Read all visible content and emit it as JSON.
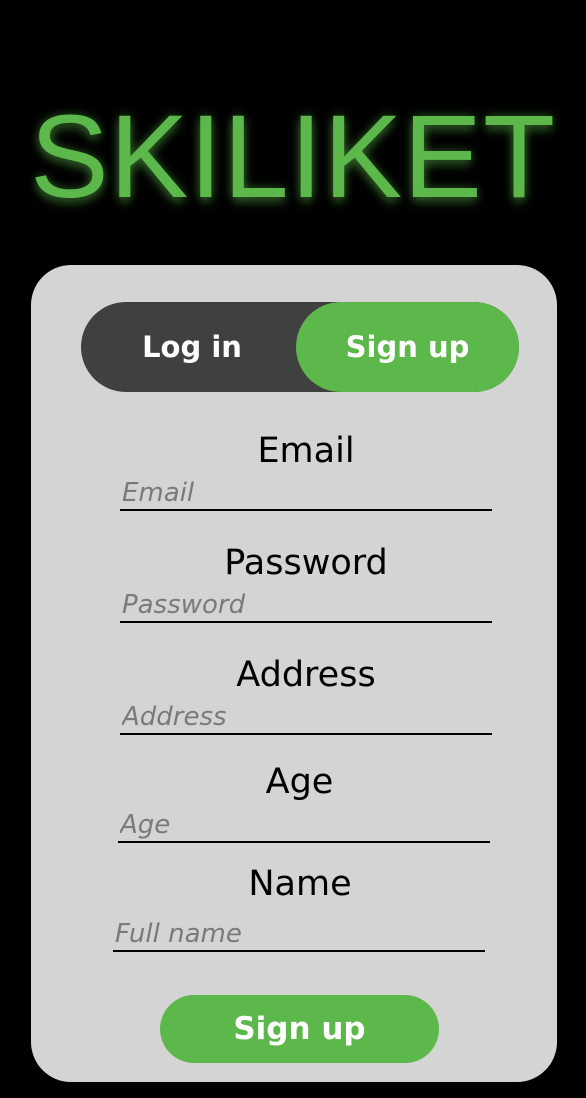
{
  "app": {
    "title": "SKILIKET"
  },
  "auth_toggle": {
    "login_label": "Log in",
    "signup_label": "Sign up",
    "active": "Sign up"
  },
  "form": {
    "fields": [
      {
        "label": "Email",
        "placeholder": "Email",
        "value": ""
      },
      {
        "label": "Password",
        "placeholder": "Password",
        "value": ""
      },
      {
        "label": "Address",
        "placeholder": "Address",
        "value": ""
      },
      {
        "label": "Age",
        "placeholder": "Age",
        "value": ""
      },
      {
        "label": "Name",
        "placeholder": "Full name",
        "value": ""
      }
    ],
    "submit_label": "Sign up"
  },
  "colors": {
    "background": "#000000",
    "accent": "#5cb84a",
    "card": "#d4d4d4",
    "toggle_inactive": "#404040"
  }
}
